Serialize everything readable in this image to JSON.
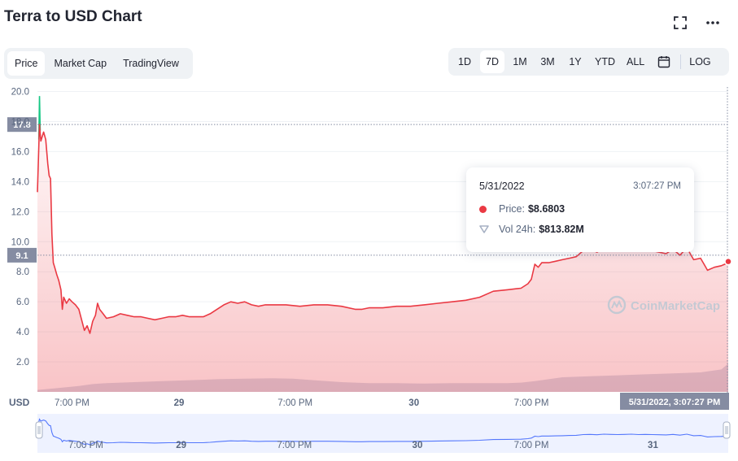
{
  "title": "Terra to USD Chart",
  "header_icons": [
    "fullscreen-icon",
    "more-icon"
  ],
  "tabs": [
    {
      "label": "Price",
      "active": true
    },
    {
      "label": "Market Cap",
      "active": false
    },
    {
      "label": "TradingView",
      "active": false
    }
  ],
  "ranges": [
    {
      "label": "1D",
      "active": false
    },
    {
      "label": "7D",
      "active": true
    },
    {
      "label": "1M",
      "active": false
    },
    {
      "label": "3M",
      "active": false
    },
    {
      "label": "1Y",
      "active": false
    },
    {
      "label": "YTD",
      "active": false
    },
    {
      "label": "ALL",
      "active": false
    }
  ],
  "log_label": "LOG",
  "tooltip": {
    "date": "5/31/2022",
    "time": "3:07:27 PM",
    "price_label": "Price:",
    "price_value": "$8.6803",
    "vol_label": "Vol 24h:",
    "vol_value": "$813.82M"
  },
  "watermark": "CoinMarketCap",
  "colors": {
    "up": "#16c784",
    "down": "#ea3943",
    "volume": "#cfd6e4",
    "tag": "#858ca2",
    "navigator_line": "#3861fb"
  },
  "chart_data": {
    "type": "line",
    "y_unit_label": "USD",
    "y_ticks": [
      "2.0",
      "4.0",
      "6.0",
      "8.0",
      "10.0",
      "12.0",
      "14.0",
      "16.0",
      "18.0",
      "20.0"
    ],
    "ylim": [
      0,
      20.3
    ],
    "x_ticks": [
      {
        "label": "7:00 PM",
        "t": 0.05,
        "bold": false
      },
      {
        "label": "29",
        "t": 0.205,
        "bold": true
      },
      {
        "label": "7:00 PM",
        "t": 0.373,
        "bold": false
      },
      {
        "label": "30",
        "t": 0.545,
        "bold": true
      },
      {
        "label": "7:00 PM",
        "t": 0.715,
        "bold": false
      }
    ],
    "crosshair_label": "5/31/2022, 3:07:27 PM",
    "tags": [
      {
        "label": "17.8",
        "value": 17.8
      },
      {
        "label": "9.1",
        "value": 9.1
      }
    ],
    "price": [
      [
        0.0,
        13.3
      ],
      [
        0.003,
        17.8
      ],
      [
        0.005,
        16.7
      ],
      [
        0.009,
        17.3
      ],
      [
        0.012,
        16.8
      ],
      [
        0.015,
        15.2
      ],
      [
        0.017,
        14.4
      ],
      [
        0.019,
        14.2
      ],
      [
        0.021,
        10.5
      ],
      [
        0.023,
        8.6
      ],
      [
        0.025,
        8.3
      ],
      [
        0.028,
        7.8
      ],
      [
        0.031,
        7.4
      ],
      [
        0.034,
        6.8
      ],
      [
        0.036,
        5.5
      ],
      [
        0.038,
        6.3
      ],
      [
        0.042,
        5.9
      ],
      [
        0.046,
        6.2
      ],
      [
        0.05,
        6.0
      ],
      [
        0.055,
        5.8
      ],
      [
        0.06,
        5.5
      ],
      [
        0.064,
        4.8
      ],
      [
        0.068,
        4.1
      ],
      [
        0.072,
        4.4
      ],
      [
        0.076,
        3.9
      ],
      [
        0.08,
        4.7
      ],
      [
        0.084,
        5.1
      ],
      [
        0.087,
        5.9
      ],
      [
        0.09,
        5.5
      ],
      [
        0.095,
        5.2
      ],
      [
        0.1,
        4.9
      ],
      [
        0.11,
        5.0
      ],
      [
        0.12,
        5.2
      ],
      [
        0.13,
        5.1
      ],
      [
        0.14,
        5.0
      ],
      [
        0.15,
        5.0
      ],
      [
        0.16,
        4.9
      ],
      [
        0.17,
        4.8
      ],
      [
        0.18,
        4.9
      ],
      [
        0.19,
        5.0
      ],
      [
        0.2,
        5.0
      ],
      [
        0.21,
        5.1
      ],
      [
        0.22,
        5.0
      ],
      [
        0.23,
        5.0
      ],
      [
        0.24,
        5.0
      ],
      [
        0.25,
        5.2
      ],
      [
        0.26,
        5.5
      ],
      [
        0.27,
        5.8
      ],
      [
        0.28,
        6.0
      ],
      [
        0.29,
        5.9
      ],
      [
        0.3,
        6.0
      ],
      [
        0.31,
        5.8
      ],
      [
        0.32,
        5.7
      ],
      [
        0.33,
        5.8
      ],
      [
        0.34,
        5.8
      ],
      [
        0.36,
        5.8
      ],
      [
        0.38,
        5.7
      ],
      [
        0.4,
        5.8
      ],
      [
        0.42,
        5.8
      ],
      [
        0.44,
        5.7
      ],
      [
        0.46,
        5.5
      ],
      [
        0.47,
        5.5
      ],
      [
        0.48,
        5.6
      ],
      [
        0.5,
        5.6
      ],
      [
        0.52,
        5.7
      ],
      [
        0.54,
        5.7
      ],
      [
        0.56,
        5.8
      ],
      [
        0.58,
        5.9
      ],
      [
        0.6,
        6.0
      ],
      [
        0.62,
        6.1
      ],
      [
        0.64,
        6.3
      ],
      [
        0.66,
        6.7
      ],
      [
        0.68,
        6.8
      ],
      [
        0.7,
        6.9
      ],
      [
        0.71,
        7.2
      ],
      [
        0.715,
        7.5
      ],
      [
        0.72,
        8.5
      ],
      [
        0.725,
        8.3
      ],
      [
        0.73,
        8.6
      ],
      [
        0.74,
        8.6
      ],
      [
        0.75,
        8.7
      ],
      [
        0.76,
        8.8
      ],
      [
        0.77,
        8.9
      ],
      [
        0.78,
        9.0
      ],
      [
        0.79,
        9.4
      ],
      [
        0.8,
        9.5
      ],
      [
        0.81,
        9.3
      ],
      [
        0.82,
        9.6
      ],
      [
        0.83,
        9.5
      ],
      [
        0.84,
        9.4
      ],
      [
        0.85,
        9.5
      ],
      [
        0.86,
        9.6
      ],
      [
        0.87,
        9.4
      ],
      [
        0.88,
        9.5
      ],
      [
        0.89,
        9.4
      ],
      [
        0.9,
        9.3
      ],
      [
        0.91,
        9.2
      ],
      [
        0.92,
        9.5
      ],
      [
        0.93,
        9.1
      ],
      [
        0.94,
        9.6
      ],
      [
        0.95,
        8.8
      ],
      [
        0.96,
        8.9
      ],
      [
        0.965,
        8.5
      ],
      [
        0.97,
        8.1
      ],
      [
        0.98,
        8.3
      ],
      [
        0.99,
        8.4
      ],
      [
        1.0,
        8.6
      ]
    ],
    "volume": [
      [
        0.0,
        0.2
      ],
      [
        0.03,
        0.4
      ],
      [
        0.06,
        0.6
      ],
      [
        0.08,
        0.8
      ],
      [
        0.1,
        0.9
      ],
      [
        0.14,
        1.0
      ],
      [
        0.18,
        1.1
      ],
      [
        0.22,
        1.2
      ],
      [
        0.26,
        1.3
      ],
      [
        0.3,
        1.35
      ],
      [
        0.34,
        1.4
      ],
      [
        0.37,
        1.35
      ],
      [
        0.4,
        1.2
      ],
      [
        0.44,
        1.0
      ],
      [
        0.48,
        0.9
      ],
      [
        0.52,
        0.9
      ],
      [
        0.56,
        0.85
      ],
      [
        0.6,
        0.9
      ],
      [
        0.64,
        0.9
      ],
      [
        0.68,
        0.9
      ],
      [
        0.7,
        0.95
      ],
      [
        0.72,
        1.1
      ],
      [
        0.74,
        1.3
      ],
      [
        0.76,
        1.5
      ],
      [
        0.8,
        1.6
      ],
      [
        0.84,
        1.7
      ],
      [
        0.88,
        1.8
      ],
      [
        0.92,
        1.9
      ],
      [
        0.96,
        2.0
      ],
      [
        0.99,
        2.3
      ],
      [
        1.0,
        2.9
      ]
    ],
    "navigator": {
      "x_ticks": [
        {
          "label": "7:00 PM",
          "t": 0.07,
          "bold": false
        },
        {
          "label": "29",
          "t": 0.208,
          "bold": true
        },
        {
          "label": "7:00 PM",
          "t": 0.372,
          "bold": false
        },
        {
          "label": "30",
          "t": 0.55,
          "bold": true
        },
        {
          "label": "7:00 PM",
          "t": 0.715,
          "bold": false
        },
        {
          "label": "31",
          "t": 0.891,
          "bold": true
        }
      ]
    },
    "tooltip_point": {
      "t": 1.0,
      "value": 8.6803
    }
  }
}
